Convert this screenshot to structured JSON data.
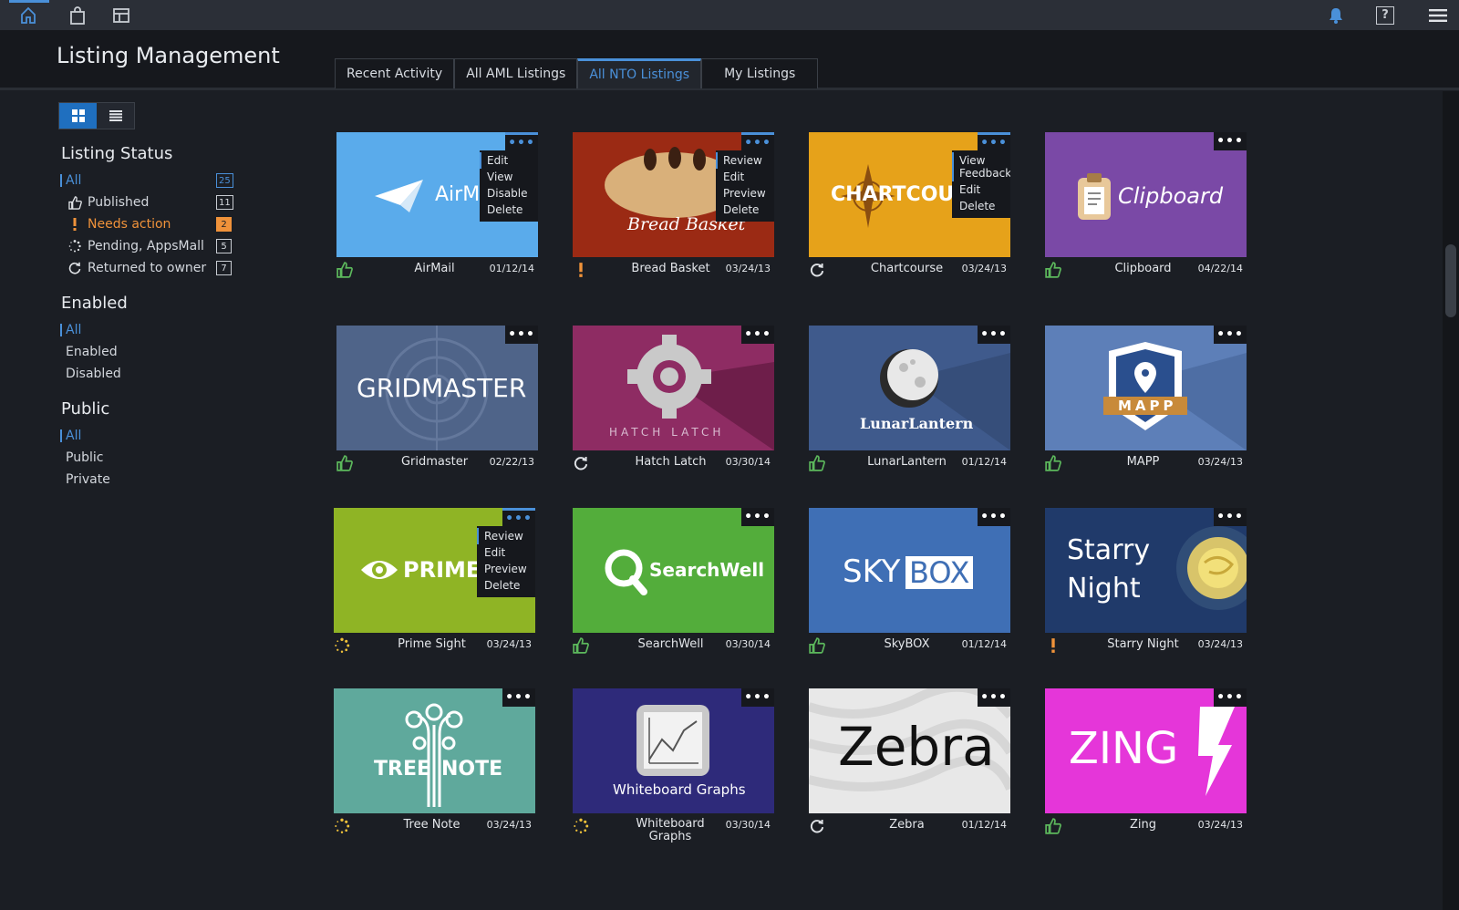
{
  "header": {
    "title": "Listing Management",
    "tabs": [
      {
        "label": "Recent Activity",
        "active": false
      },
      {
        "label": "All AML Listings",
        "active": false
      },
      {
        "label": "All NTO Listings",
        "active": true
      },
      {
        "label": "My Listings",
        "active": false
      }
    ]
  },
  "topbar": {
    "icons": [
      "home-icon",
      "bag-icon",
      "layout-icon",
      "bell-icon",
      "help-icon",
      "menu-icon"
    ],
    "help_glyph": "?"
  },
  "view_toggle": {
    "icons": [
      "grid-view-icon",
      "list-view-icon"
    ],
    "active": "grid"
  },
  "sidebar": {
    "status": {
      "title": "Listing Status",
      "items": [
        {
          "label": "All",
          "count": "25",
          "icon": "",
          "selected": true
        },
        {
          "label": "Published",
          "count": "11",
          "icon": "thumbs-up-icon"
        },
        {
          "label": "Needs action",
          "count": "2",
          "icon": "exclamation-icon"
        },
        {
          "label": "Pending, AppsMall",
          "count": "5",
          "icon": "spinner-icon"
        },
        {
          "label": "Returned to owner",
          "count": "7",
          "icon": "refresh-icon"
        }
      ]
    },
    "enabled": {
      "title": "Enabled",
      "items": [
        {
          "label": "All",
          "selected": true
        },
        {
          "label": "Enabled"
        },
        {
          "label": "Disabled"
        }
      ]
    },
    "public": {
      "title": "Public",
      "items": [
        {
          "label": "All",
          "selected": true
        },
        {
          "label": "Public"
        },
        {
          "label": "Private"
        }
      ]
    }
  },
  "listings": [
    {
      "name": "AirMail",
      "date": "01/12/14",
      "status": "published",
      "thumb_text": "AirMa",
      "bg": "#5aabeb",
      "menu": [
        "Edit",
        "View",
        "Disable",
        "Delete"
      ]
    },
    {
      "name": "Bread Basket",
      "date": "03/24/13",
      "status": "needs-action",
      "thumb_text": "Bread Basket",
      "bg": "#9b2a14",
      "menu": [
        "Review",
        "Edit",
        "Preview",
        "Delete"
      ]
    },
    {
      "name": "Chartcourse",
      "date": "03/24/13",
      "status": "returned",
      "thumb_text": "CHARTCOU",
      "bg": "#e6a21a",
      "menu": [
        "View Feedback",
        "Edit",
        "Delete"
      ]
    },
    {
      "name": "Clipboard",
      "date": "04/22/14",
      "status": "published",
      "thumb_text": "Clipboard",
      "bg": "#7a49a6"
    },
    {
      "name": "Gridmaster",
      "date": "02/22/13",
      "status": "published",
      "thumb_text": "GRIDMASTER",
      "bg": "#4f6489"
    },
    {
      "name": "Hatch Latch",
      "date": "03/30/14",
      "status": "returned",
      "thumb_text": "HATCH LATCH",
      "bg": "#8e2c63"
    },
    {
      "name": "LunarLantern",
      "date": "01/12/14",
      "status": "published",
      "thumb_text": "LunarLantern",
      "bg": "#3f5a8c"
    },
    {
      "name": "MAPP",
      "date": "03/24/13",
      "status": "published",
      "thumb_text": "MAPP",
      "bg": "#5d7fb8"
    },
    {
      "name": "Prime Sight",
      "date": "03/24/13",
      "status": "pending",
      "thumb_text": "PRIMESI",
      "bg": "#8fb425",
      "menu": [
        "Review",
        "Edit",
        "Preview",
        "Delete"
      ]
    },
    {
      "name": "SearchWell",
      "date": "03/30/14",
      "status": "published",
      "thumb_text": "SearchWell",
      "bg": "#53ad3b"
    },
    {
      "name": "SkyBOX",
      "date": "01/12/14",
      "status": "published",
      "thumb_text_a": "SKY",
      "thumb_text_b": "BOX",
      "bg": "#3f6fb5"
    },
    {
      "name": "Starry Night",
      "date": "03/24/13",
      "status": "needs-action",
      "thumb_text_a": "Starry",
      "thumb_text_b": "Night",
      "bg": "#203a6a"
    },
    {
      "name": "Tree Note",
      "date": "03/24/13",
      "status": "pending",
      "thumb_text_a": "TREE",
      "thumb_text_b": "NOTE",
      "bg": "#5fa99c"
    },
    {
      "name": "Whiteboard Graphs",
      "date": "03/30/14",
      "status": "pending",
      "thumb_text": "Whiteboard Graphs",
      "bg": "#2e2a7a"
    },
    {
      "name": "Zebra",
      "date": "01/12/14",
      "status": "returned",
      "thumb_text": "Zebra",
      "bg": "#e8e8e8"
    },
    {
      "name": "Zing",
      "date": "03/24/13",
      "status": "published",
      "thumb_text": "ZING",
      "bg": "#e536d9"
    }
  ],
  "more_label": "•••",
  "colors": {
    "accent": "#4a90d9",
    "published": "#5cb85c",
    "warning": "#f0923a",
    "pending": "#f0c23a"
  }
}
